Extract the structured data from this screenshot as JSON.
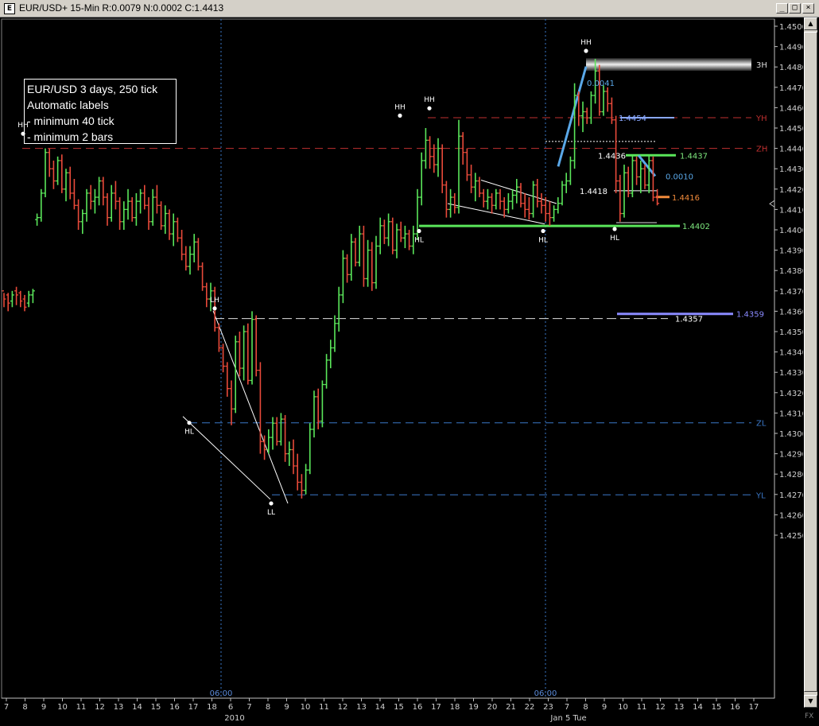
{
  "window": {
    "title": "EUR/USD+ 15-Min R:0.0079 N:0.0002 C:1.4413",
    "icon": "chart-icon",
    "min_glyph": "_",
    "max_glyph": "□",
    "close_glyph": "×"
  },
  "info_box": {
    "lines": [
      "EUR/USD 3 days, 250 tick",
      "Automatic labels",
      "- minimum 40 tick",
      "- minimum 2 bars"
    ]
  },
  "corner_label": "FX",
  "chart_data": {
    "type": "ohlc-bar",
    "ylim": [
      1.425,
      1.4503
    ],
    "y_ticks": [
      "1.4500",
      "1.4490",
      "1.4480",
      "1.4470",
      "1.4460",
      "1.4450",
      "1.4440",
      "1.4430",
      "1.4420",
      "1.4410",
      "1.4400",
      "1.4390",
      "1.4380",
      "1.4370",
      "1.4360",
      "1.4350",
      "1.4340",
      "1.4330",
      "1.4320",
      "1.4310",
      "1.4300",
      "1.4290",
      "1.4280",
      "1.4270",
      "1.4260",
      "1.4250"
    ],
    "x_ticks": [
      "7",
      "8",
      "9",
      "10",
      "11",
      "12",
      "13",
      "14",
      "15",
      "16",
      "17",
      "18",
      "6",
      "7",
      "8",
      "9",
      "10",
      "11",
      "12",
      "13",
      "14",
      "15",
      "16",
      "17",
      "18",
      "19",
      "20",
      "21",
      "22",
      "23",
      "7",
      "8",
      "9",
      "10",
      "11",
      "12",
      "13",
      "14",
      "15",
      "16",
      "17"
    ],
    "x_sublabels": [
      "2010",
      "Jan 5 Tue"
    ],
    "session_markers": [
      "06:00",
      "06:00"
    ],
    "up_color": "#5ae65a",
    "down_color": "#e84a3a",
    "bars": [
      [
        1.437,
        1.4369,
        1.4362,
        1.4366
      ],
      [
        1.4368,
        1.4369,
        1.436,
        1.4364
      ],
      [
        1.4365,
        1.437,
        1.4362,
        1.4368
      ],
      [
        1.437,
        1.4372,
        1.4363,
        1.4368
      ],
      [
        1.4369,
        1.437,
        1.4362,
        1.4365
      ],
      [
        1.4366,
        1.4368,
        1.436,
        1.4362
      ],
      [
        1.4364,
        1.437,
        1.4362,
        1.4368
      ],
      [
        1.4368,
        1.4371,
        1.4364,
        1.437
      ],
      [
        1.4405,
        1.4408,
        1.4402,
        1.4406
      ],
      [
        1.4406,
        1.442,
        1.4404,
        1.4418
      ],
      [
        1.4418,
        1.444,
        1.4416,
        1.4438
      ],
      [
        1.4438,
        1.444,
        1.4426,
        1.443
      ],
      [
        1.443,
        1.4434,
        1.442,
        1.4424
      ],
      [
        1.4424,
        1.4436,
        1.4422,
        1.4434
      ],
      [
        1.4434,
        1.4437,
        1.4418,
        1.442
      ],
      [
        1.442,
        1.443,
        1.4414,
        1.4428
      ],
      [
        1.4428,
        1.4431,
        1.4415,
        1.4418
      ],
      [
        1.4418,
        1.4425,
        1.441,
        1.4412
      ],
      [
        1.4412,
        1.4415,
        1.44,
        1.4404
      ],
      [
        1.4404,
        1.441,
        1.4398,
        1.4408
      ],
      [
        1.4408,
        1.442,
        1.4404,
        1.4418
      ],
      [
        1.4418,
        1.4422,
        1.441,
        1.4414
      ],
      [
        1.4414,
        1.442,
        1.4408,
        1.4416
      ],
      [
        1.4416,
        1.4426,
        1.4412,
        1.4424
      ],
      [
        1.4424,
        1.4426,
        1.4412,
        1.4416
      ],
      [
        1.4416,
        1.4418,
        1.4402,
        1.4406
      ],
      [
        1.4406,
        1.4422,
        1.4404,
        1.4418
      ],
      [
        1.4418,
        1.4424,
        1.441,
        1.4414
      ],
      [
        1.4414,
        1.4416,
        1.44,
        1.4404
      ],
      [
        1.4404,
        1.4414,
        1.44,
        1.441
      ],
      [
        1.441,
        1.442,
        1.4405,
        1.4414
      ],
      [
        1.4414,
        1.4416,
        1.4404,
        1.4406
      ],
      [
        1.4406,
        1.4418,
        1.4402,
        1.4414
      ],
      [
        1.4414,
        1.442,
        1.4408,
        1.4418
      ],
      [
        1.4418,
        1.4422,
        1.441,
        1.4412
      ],
      [
        1.4412,
        1.4416,
        1.44,
        1.4404
      ],
      [
        1.4404,
        1.442,
        1.4402,
        1.4416
      ],
      [
        1.4416,
        1.4422,
        1.4408,
        1.4412
      ],
      [
        1.4412,
        1.4414,
        1.44,
        1.4402
      ],
      [
        1.4402,
        1.4412,
        1.4398,
        1.4408
      ],
      [
        1.4408,
        1.441,
        1.4395,
        1.4398
      ],
      [
        1.4398,
        1.4408,
        1.4392,
        1.4404
      ],
      [
        1.4404,
        1.4406,
        1.4394,
        1.4396
      ],
      [
        1.4396,
        1.44,
        1.4385,
        1.4388
      ],
      [
        1.4388,
        1.4392,
        1.438,
        1.4382
      ],
      [
        1.4382,
        1.4392,
        1.4378,
        1.4388
      ],
      [
        1.4388,
        1.4398,
        1.4384,
        1.4394
      ],
      [
        1.4394,
        1.4396,
        1.438,
        1.4382
      ],
      [
        1.4382,
        1.4384,
        1.437,
        1.4372
      ],
      [
        1.4372,
        1.4374,
        1.4362,
        1.4366
      ],
      [
        1.4366,
        1.4374,
        1.436,
        1.437
      ],
      [
        1.437,
        1.4372,
        1.435,
        1.4352
      ],
      [
        1.4352,
        1.4354,
        1.434,
        1.4342
      ],
      [
        1.4342,
        1.4344,
        1.433,
        1.4333
      ],
      [
        1.4333,
        1.4335,
        1.4318,
        1.4322
      ],
      [
        1.4322,
        1.4326,
        1.4304,
        1.4312
      ],
      [
        1.4312,
        1.4348,
        1.431,
        1.4345
      ],
      [
        1.4345,
        1.435,
        1.4328,
        1.4332
      ],
      [
        1.4332,
        1.4353,
        1.4326,
        1.435
      ],
      [
        1.435,
        1.4354,
        1.4324,
        1.4326
      ],
      [
        1.4326,
        1.436,
        1.4324,
        1.4356
      ],
      [
        1.4356,
        1.4358,
        1.4328,
        1.4331
      ],
      [
        1.4331,
        1.4335,
        1.429,
        1.4296
      ],
      [
        1.4296,
        1.4299,
        1.4287,
        1.4292
      ],
      [
        1.4292,
        1.4302,
        1.429,
        1.4298
      ],
      [
        1.4298,
        1.4308,
        1.4292,
        1.4305
      ],
      [
        1.4305,
        1.4308,
        1.4294,
        1.4296
      ],
      [
        1.4296,
        1.431,
        1.4294,
        1.4307
      ],
      [
        1.4307,
        1.4309,
        1.4286,
        1.429
      ],
      [
        1.429,
        1.4296,
        1.4284,
        1.4292
      ],
      [
        1.4292,
        1.4297,
        1.428,
        1.4284
      ],
      [
        1.4284,
        1.429,
        1.4272,
        1.4276
      ],
      [
        1.4276,
        1.428,
        1.4268,
        1.4272
      ],
      [
        1.4272,
        1.4285,
        1.427,
        1.4282
      ],
      [
        1.4282,
        1.4305,
        1.428,
        1.4302
      ],
      [
        1.4302,
        1.4321,
        1.4298,
        1.4318
      ],
      [
        1.4318,
        1.4322,
        1.4302,
        1.4306
      ],
      [
        1.4306,
        1.4326,
        1.4303,
        1.4324
      ],
      [
        1.4324,
        1.4339,
        1.4322,
        1.4336
      ],
      [
        1.4336,
        1.4346,
        1.4332,
        1.4342
      ],
      [
        1.4342,
        1.4358,
        1.434,
        1.4354
      ],
      [
        1.4354,
        1.4372,
        1.435,
        1.4368
      ],
      [
        1.4368,
        1.439,
        1.4364,
        1.4386
      ],
      [
        1.4386,
        1.4388,
        1.4374,
        1.4378
      ],
      [
        1.4378,
        1.4398,
        1.4375,
        1.4394
      ],
      [
        1.4394,
        1.4396,
        1.4382,
        1.4384
      ],
      [
        1.4384,
        1.4402,
        1.4382,
        1.4398
      ],
      [
        1.4398,
        1.4402,
        1.4372,
        1.4376
      ],
      [
        1.4376,
        1.4395,
        1.4372,
        1.439
      ],
      [
        1.439,
        1.4394,
        1.437,
        1.4374
      ],
      [
        1.4374,
        1.4397,
        1.4371,
        1.4392
      ],
      [
        1.4392,
        1.4406,
        1.4388,
        1.4402
      ],
      [
        1.4402,
        1.4405,
        1.4393,
        1.4396
      ],
      [
        1.4396,
        1.4408,
        1.4392,
        1.4404
      ],
      [
        1.4404,
        1.4406,
        1.4388,
        1.439
      ],
      [
        1.439,
        1.4403,
        1.4386,
        1.44
      ],
      [
        1.44,
        1.4404,
        1.4394,
        1.4396
      ],
      [
        1.4396,
        1.4402,
        1.4391,
        1.4398
      ],
      [
        1.4398,
        1.44,
        1.439,
        1.4392
      ],
      [
        1.4392,
        1.4402,
        1.4388,
        1.4398
      ],
      [
        1.4398,
        1.442,
        1.4395,
        1.4416
      ],
      [
        1.4416,
        1.4438,
        1.4412,
        1.4434
      ],
      [
        1.4434,
        1.445,
        1.443,
        1.4444
      ],
      [
        1.4444,
        1.4446,
        1.443,
        1.4436
      ],
      [
        1.4436,
        1.4442,
        1.4428,
        1.4432
      ],
      [
        1.4432,
        1.4445,
        1.4426,
        1.444
      ],
      [
        1.444,
        1.4442,
        1.4418,
        1.4422
      ],
      [
        1.4422,
        1.4424,
        1.4406,
        1.441
      ],
      [
        1.441,
        1.442,
        1.4406,
        1.4416
      ],
      [
        1.4416,
        1.4418,
        1.4408,
        1.4411
      ],
      [
        1.4411,
        1.4454,
        1.4408,
        1.4446
      ],
      [
        1.4446,
        1.4448,
        1.4432,
        1.4438
      ],
      [
        1.4438,
        1.444,
        1.4424,
        1.4427
      ],
      [
        1.4427,
        1.4432,
        1.4418,
        1.4421
      ],
      [
        1.4421,
        1.4428,
        1.4414,
        1.4424
      ],
      [
        1.4424,
        1.4426,
        1.4416,
        1.4418
      ],
      [
        1.4418,
        1.442,
        1.4411,
        1.4414
      ],
      [
        1.4414,
        1.442,
        1.441,
        1.4416
      ],
      [
        1.4416,
        1.4418,
        1.4408,
        1.4412
      ],
      [
        1.4412,
        1.442,
        1.441,
        1.4418
      ],
      [
        1.4418,
        1.442,
        1.441,
        1.4414
      ],
      [
        1.4414,
        1.4416,
        1.4406,
        1.441
      ],
      [
        1.441,
        1.4418,
        1.4408,
        1.4414
      ],
      [
        1.4414,
        1.442,
        1.441,
        1.4417
      ],
      [
        1.4417,
        1.4425,
        1.4413,
        1.4421
      ],
      [
        1.4421,
        1.4423,
        1.4411,
        1.4413
      ],
      [
        1.4413,
        1.4418,
        1.4406,
        1.441
      ],
      [
        1.441,
        1.4416,
        1.4405,
        1.4408
      ],
      [
        1.4408,
        1.4424,
        1.4406,
        1.4422
      ],
      [
        1.4422,
        1.4425,
        1.4411,
        1.4414
      ],
      [
        1.4414,
        1.4418,
        1.4408,
        1.4412
      ],
      [
        1.4412,
        1.4416,
        1.4404,
        1.4408
      ],
      [
        1.4408,
        1.4414,
        1.4402,
        1.4406
      ],
      [
        1.4406,
        1.4412,
        1.4404,
        1.441
      ],
      [
        1.441,
        1.4416,
        1.4408,
        1.4413
      ],
      [
        1.4413,
        1.4424,
        1.4412,
        1.4422
      ],
      [
        1.4422,
        1.4428,
        1.4418,
        1.4424
      ],
      [
        1.4424,
        1.4436,
        1.4422,
        1.4434
      ],
      [
        1.4434,
        1.4472,
        1.443,
        1.4466
      ],
      [
        1.4466,
        1.4468,
        1.4451,
        1.4456
      ],
      [
        1.4456,
        1.4463,
        1.4448,
        1.4458
      ],
      [
        1.4458,
        1.446,
        1.4452,
        1.4455
      ],
      [
        1.4455,
        1.4468,
        1.4452,
        1.4466
      ],
      [
        1.4466,
        1.4484,
        1.4462,
        1.4478
      ],
      [
        1.4478,
        1.4481,
        1.4456,
        1.4458
      ],
      [
        1.4458,
        1.4471,
        1.4456,
        1.4468
      ],
      [
        1.4468,
        1.447,
        1.4458,
        1.4462
      ],
      [
        1.4462,
        1.4465,
        1.4452,
        1.4454
      ],
      [
        1.4454,
        1.4456,
        1.4418,
        1.4424
      ],
      [
        1.4424,
        1.4427,
        1.4404,
        1.4408
      ],
      [
        1.4408,
        1.4432,
        1.4406,
        1.4428
      ],
      [
        1.4428,
        1.4431,
        1.4416,
        1.4418
      ],
      [
        1.4418,
        1.4437,
        1.4416,
        1.4434
      ],
      [
        1.4434,
        1.4436,
        1.4422,
        1.4426
      ],
      [
        1.4426,
        1.4434,
        1.4418,
        1.443
      ],
      [
        1.443,
        1.4432,
        1.442,
        1.4422
      ],
      [
        1.4422,
        1.4437,
        1.4418,
        1.4434
      ],
      [
        1.4434,
        1.4436,
        1.4414,
        1.4416
      ],
      [
        1.4416,
        1.442,
        1.4412,
        1.4413
      ]
    ],
    "levels": [
      {
        "label": "YH",
        "value": 1.44551,
        "color": "#c03030"
      },
      {
        "label": "ZH",
        "value": 1.444,
        "color": "#c03030"
      },
      {
        "label": "ZL",
        "value": 1.43052,
        "color": "#3a78c8"
      },
      {
        "label": "YL",
        "value": 1.42698,
        "color": "#3a78c8"
      },
      {
        "label": "3H",
        "value": 1.44812,
        "color": "#ffffff"
      }
    ],
    "swing_labels": [
      {
        "text": "HH",
        "value": 1.44472,
        "bar": 1
      },
      {
        "text": "LH",
        "value": 1.43614,
        "bar": 11
      },
      {
        "text": "HL",
        "value": 1.43052,
        "bar": 10
      },
      {
        "text": "LL",
        "value": 1.42656,
        "bar": 15
      },
      {
        "text": "HH",
        "value": 1.44561,
        "bar": 22
      },
      {
        "text": "HH",
        "value": 1.44597,
        "bar": 24
      },
      {
        "text": "HL",
        "value": 1.43994,
        "bar": 23
      },
      {
        "text": "HL",
        "value": 1.43994,
        "bar": 30
      },
      {
        "text": "HH",
        "value": 1.44879,
        "bar": 33
      },
      {
        "text": "HL",
        "value": 1.44004,
        "bar": 35
      }
    ],
    "price_labels": [
      {
        "text": "1.4454",
        "value": 1.44551,
        "color": "#8aa8ff"
      },
      {
        "text": "1.4437",
        "value": 1.44366,
        "color": "#7ee87e"
      },
      {
        "text": "1.4436",
        "value": 1.44366,
        "color": "#ffffff"
      },
      {
        "text": "0.0010",
        "value": 1.44264,
        "color": "#5aa8e8"
      },
      {
        "text": "1.4418",
        "value": 1.44192,
        "color": "#ffffff"
      },
      {
        "text": "1.4416",
        "value": 1.44161,
        "color": "#f08a3a"
      },
      {
        "text": "1.4402",
        "value": 1.44019,
        "color": "#7ee87e"
      },
      {
        "text": "1.4359",
        "value": 1.43587,
        "color": "#8a8aff"
      },
      {
        "text": "1.4357",
        "value": 1.43564,
        "color": "#ffffff"
      },
      {
        "text": "0.0041",
        "value": 1.44722,
        "color": "#5aa8e8"
      }
    ]
  }
}
